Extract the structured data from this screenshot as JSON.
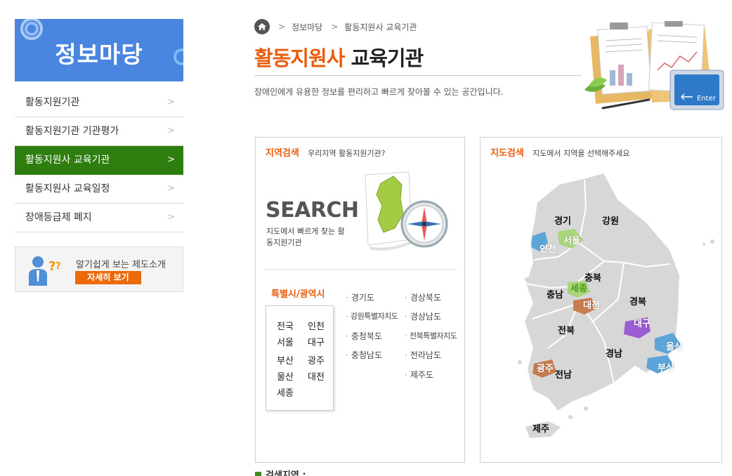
{
  "sidebar": {
    "title": "정보마당",
    "items": [
      {
        "label": "활동지원기관",
        "arrow": ">"
      },
      {
        "label": "활동지원기관 기관평가",
        "arrow": ">"
      },
      {
        "label": "활동지원사 교육기관",
        "arrow": ">",
        "active": true
      },
      {
        "label": "활동지원사 교육일정",
        "arrow": ">"
      },
      {
        "label": "장애등급제 폐지",
        "arrow": ">"
      }
    ],
    "intro": {
      "text": "알기쉽게 보는 제도소개",
      "button": "자세히 보기"
    }
  },
  "breadcrumb": {
    "items": [
      "정보마당",
      "활동지원사 교육기관"
    ],
    "separator": ">"
  },
  "header": {
    "title_highlight": "활동지원사",
    "title_rest": "교육기관",
    "description": "장애인에게 유용한 정보를 편리하고 빠르게 찾아볼 수 있는 공간입니다.",
    "enter_key_label": "Enter"
  },
  "region_search": {
    "title": "지역검색",
    "subtitle": "우리지역 활동지원기관?",
    "search_word": "SEARCH",
    "search_caption": "지도에서 빠르게 찾는 활동지원기관",
    "metro_heading": "특별시/광역시",
    "metro_cities": [
      "전국",
      "인천",
      "서울",
      "대구",
      "부산",
      "광주",
      "울산",
      "대전",
      "세종"
    ],
    "provinces_col1": [
      "경기도",
      "강원특별자치도",
      "충청북도",
      "충청남도"
    ],
    "provinces_col2": [
      "경상북도",
      "경상남도",
      "전북특별자치도",
      "전라남도",
      "제주도"
    ]
  },
  "map_search": {
    "title": "지도검색",
    "subtitle": "지도에서 지역을 선택해주세요",
    "regions": {
      "gyeonggi": "경기",
      "gangwon": "강원",
      "seoul": "서울",
      "incheon": "인천",
      "chungbuk": "충북",
      "chungnam": "충남",
      "sejong": "세종",
      "daejeon": "대전",
      "gyeongbuk": "경북",
      "daegu": "대구",
      "jeonbuk": "전북",
      "gyeongnam": "경남",
      "ulsan": "울산",
      "busan": "부산",
      "gwangju": "광주",
      "jeonnam": "전남",
      "jeju": "제주"
    }
  },
  "results": {
    "label": "검색지역 :"
  },
  "colors": {
    "accent_orange": "#ea5b0c",
    "active_green": "#2e7d0f",
    "sidebar_blue": "#4a86e0"
  }
}
